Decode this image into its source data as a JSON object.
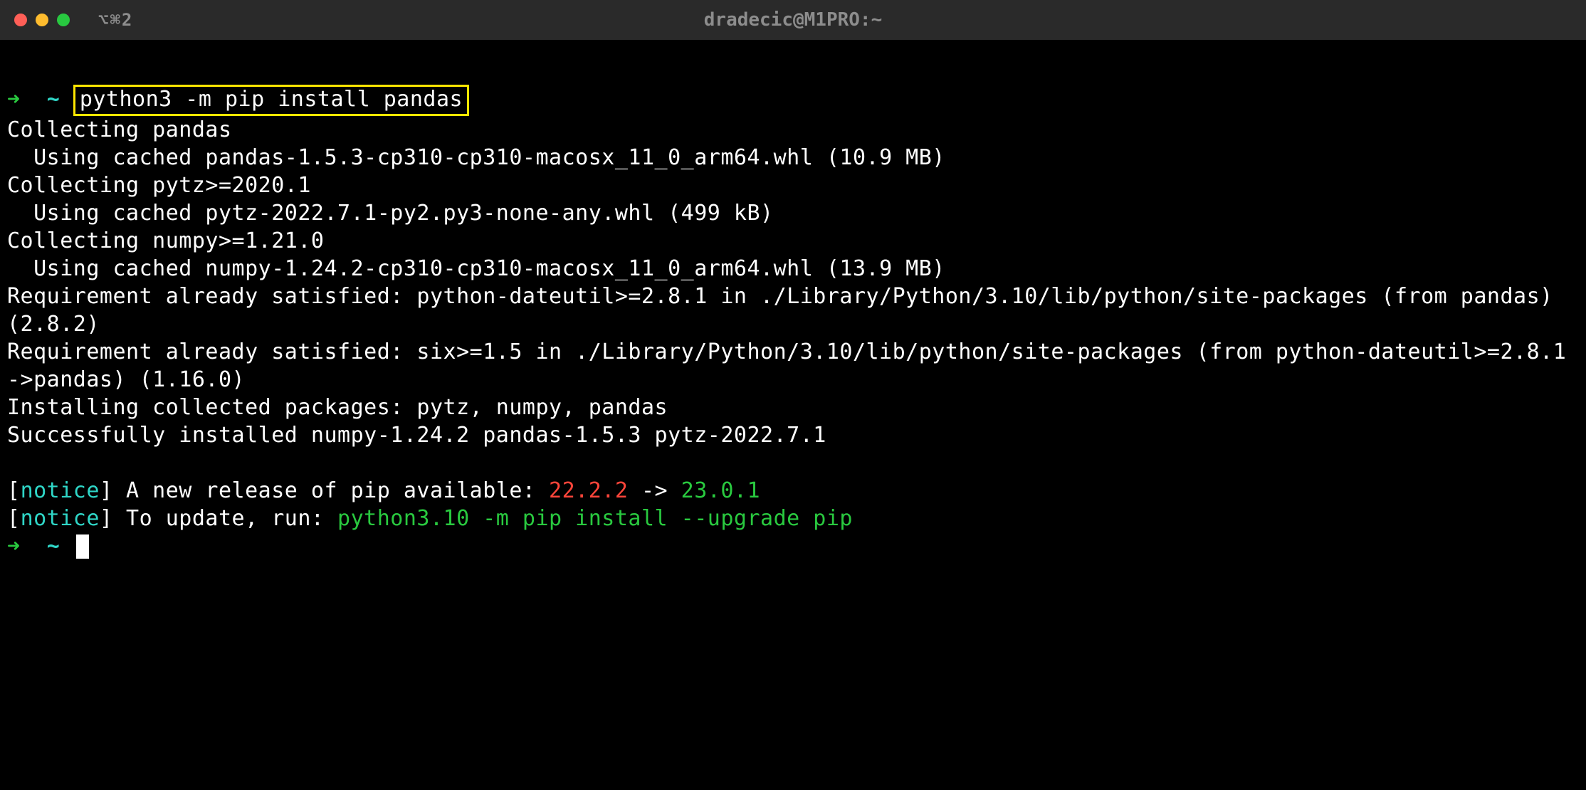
{
  "titlebar": {
    "shortcut": "⌥⌘2",
    "title": "dradecic@M1PRO:~"
  },
  "prompt": {
    "arrow": "➜",
    "tilde": "~",
    "command": "python3 -m pip install pandas"
  },
  "output": {
    "line1": "Collecting pandas",
    "line2": "  Using cached pandas-1.5.3-cp310-cp310-macosx_11_0_arm64.whl (10.9 MB)",
    "line3": "Collecting pytz>=2020.1",
    "line4": "  Using cached pytz-2022.7.1-py2.py3-none-any.whl (499 kB)",
    "line5": "Collecting numpy>=1.21.0",
    "line6": "  Using cached numpy-1.24.2-cp310-cp310-macosx_11_0_arm64.whl (13.9 MB)",
    "line7": "Requirement already satisfied: python-dateutil>=2.8.1 in ./Library/Python/3.10/lib/python/site-packages (from pandas) (2.8.2)",
    "line8": "Requirement already satisfied: six>=1.5 in ./Library/Python/3.10/lib/python/site-packages (from python-dateutil>=2.8.1->pandas) (1.16.0)",
    "line9": "Installing collected packages: pytz, numpy, pandas",
    "line10": "Successfully installed numpy-1.24.2 pandas-1.5.3 pytz-2022.7.1"
  },
  "notice": {
    "bracket_open": "[",
    "label": "notice",
    "bracket_close": "]",
    "msg1_pre": " A new release of pip available: ",
    "old_version": "22.2.2",
    "arrow_sep": " -> ",
    "new_version": "23.0.1",
    "msg2_pre": " To update, run: ",
    "update_cmd": "python3.10 -m pip install --upgrade pip"
  }
}
